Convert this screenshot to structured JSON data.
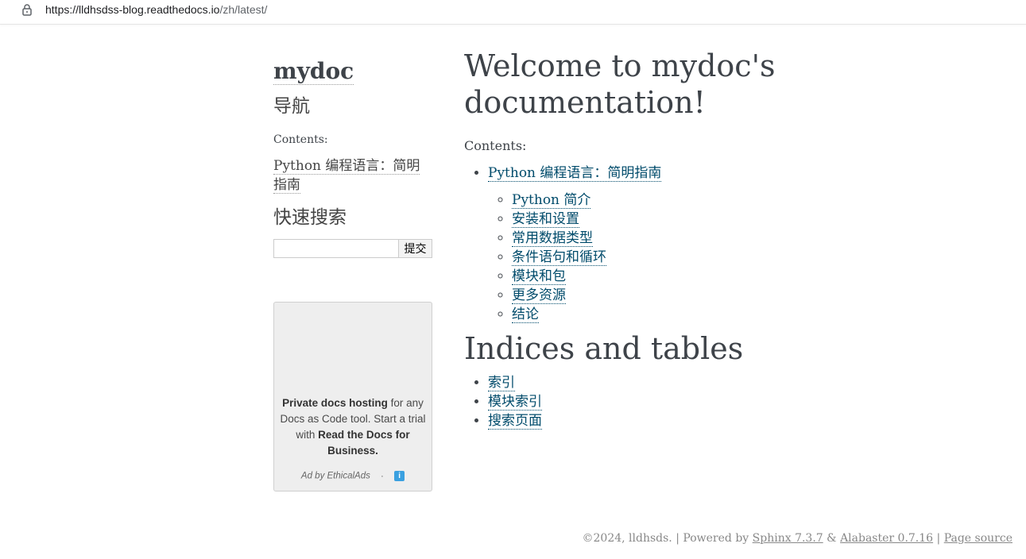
{
  "address_bar": {
    "url_host": "https://lldhsdss-blog.readthedocs.io",
    "url_path": "/zh/latest/"
  },
  "sidebar": {
    "logo": "mydoc",
    "nav_heading": "导航",
    "contents_caption": "Contents:",
    "nav_link": "Python 编程语言：简明指南",
    "search_heading": "快速搜索",
    "search_placeholder": "",
    "search_button": "提交"
  },
  "ad": {
    "bold1": "Private docs hosting",
    "text1": " for any Docs as Code tool. Start a trial with ",
    "bold2": "Read the Docs for Business.",
    "footer": "Ad by EthicalAds",
    "separator": "·",
    "info_icon": "i"
  },
  "main": {
    "title": "Welcome to mydoc's documentation!",
    "contents_caption": "Contents:",
    "toc_top": "Python 编程语言：简明指南",
    "toc_sub": [
      "Python 简介",
      "安装和设置",
      "常用数据类型",
      "条件语句和循环",
      "模块和包",
      "更多资源",
      "结论"
    ],
    "indices_title": "Indices and tables",
    "indices": [
      "索引",
      "模块索引",
      "搜索页面"
    ]
  },
  "footer": {
    "copyright": "©2024, lldhsds.",
    "sep1": " | Powered by ",
    "sphinx": "Sphinx 7.3.7",
    "amp": " & ",
    "alabaster": "Alabaster 0.7.16",
    "sep2": " | ",
    "page_source": "Page source"
  }
}
